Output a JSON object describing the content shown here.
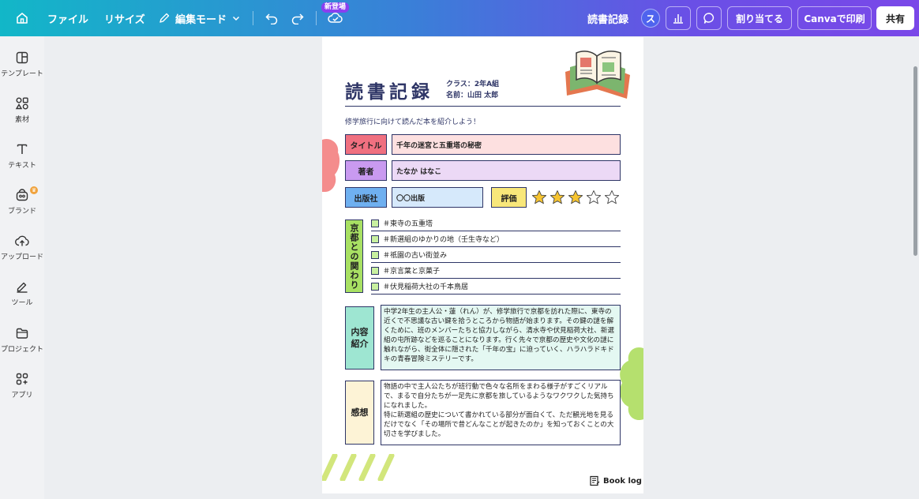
{
  "topbar": {
    "file": "ファイル",
    "resize": "リサイズ",
    "edit_mode": "編集モード",
    "new_badge": "新登場",
    "reading_record": "読書記録",
    "avatar_initial": "ス",
    "assign": "割り当てる",
    "print": "Canvaで印刷",
    "share": "共有"
  },
  "sidebar": {
    "items": [
      {
        "label": "テンプレート",
        "icon": "template-icon"
      },
      {
        "label": "素材",
        "icon": "elements-icon"
      },
      {
        "label": "テキスト",
        "icon": "text-icon"
      },
      {
        "label": "ブランド",
        "icon": "brand-icon"
      },
      {
        "label": "アップロード",
        "icon": "upload-icon"
      },
      {
        "label": "ツール",
        "icon": "tools-icon"
      },
      {
        "label": "プロジェクト",
        "icon": "folder-icon"
      },
      {
        "label": "アプリ",
        "icon": "apps-icon"
      }
    ]
  },
  "doc": {
    "title": "読書記録",
    "class_line": "クラス：2年A組",
    "name_line": "名前：山田 太郎",
    "intro": "修学旅行に向けて読んだ本を紹介しよう！",
    "fields": {
      "title_label": "タイトル",
      "title_value": "千年の迷宮と五重塔の秘密",
      "author_label": "著者",
      "author_value": "たなか はなこ",
      "publisher_label": "出版社",
      "publisher_value": "〇〇出版",
      "rating_label": "評価"
    },
    "rating": {
      "filled": 3,
      "total": 5
    },
    "kyoto": {
      "label": "京都との関わり",
      "items": [
        "＃東寺の五重塔",
        "＃新選組のゆかりの地（壬生寺など）",
        "＃祇園の古い街並み",
        "＃京言葉と京菓子",
        "＃伏見稲荷大社の千本鳥居"
      ]
    },
    "summary": {
      "label_line1": "内容",
      "label_line2": "紹介",
      "text": "中学2年生の主人公・蓮（れん）が、修学旅行で京都を訪れた際に、東寺の近くで不思議な古い鍵を拾うところから物語が始まります。その鍵の謎を解くために、班のメンバーたちと協力しながら、清水寺や伏見稲荷大社、新選組の屯所跡などを巡ることになります。行く先々で京都の歴史や文化の謎に触れながら、街全体に隠された「千年の宝」に迫っていく、ハラハラドキドキの青春冒険ミステリーです。"
    },
    "impression": {
      "label": "感想",
      "text_p1": "物語の中で主人公たちが班行動で色々な名所をまわる様子がすごくリアルで、まるで自分たちが一足先に京都を旅しているようなワクワクした気持ちになれました。",
      "text_p2": "特に新選組の歴史について書かれている部分が面白くて、ただ観光地を見るだけでなく「その場所で昔どんなことが起きたのか」を知っておくことの大切さを学びました。"
    },
    "footer": "Book log"
  },
  "colors": {
    "brand_gradient": [
      "#12b7c8",
      "#6a4fe6"
    ],
    "title_label": "#f07080",
    "title_value": "#fde0e0",
    "author_label": "#c99af0",
    "author_value": "#ecd9f6",
    "publisher_label": "#6fb0f0",
    "publisher_value": "#d6e9fb",
    "rating_label": "#f8e77a",
    "kyoto_label": "#a8e063",
    "summary_label": "#9ee6d2",
    "summary_text": "#e4f8f2",
    "impression_label": "#fdf3d6",
    "star": "#f6c431",
    "ink": "#2e3566"
  }
}
